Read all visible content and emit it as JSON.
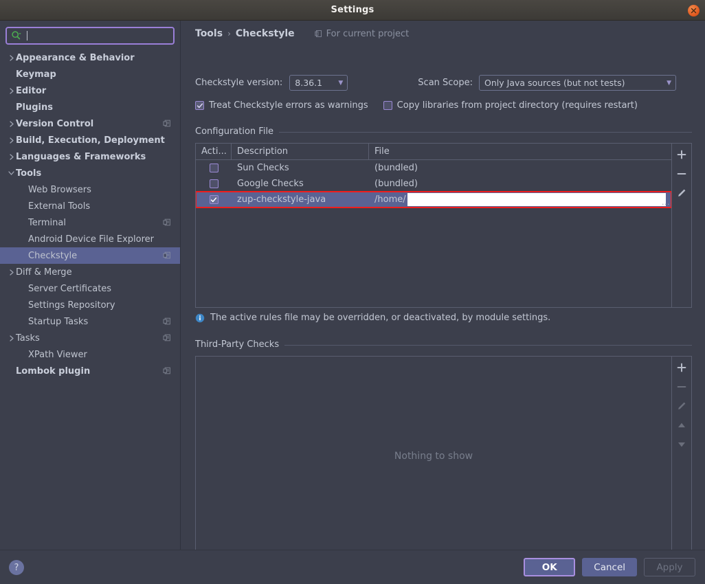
{
  "window": {
    "title": "Settings",
    "close_icon": "close-icon"
  },
  "sidebar": {
    "search": {
      "placeholder": "",
      "value": "",
      "icon": "search-icon"
    },
    "items": [
      {
        "label": "Appearance & Behavior",
        "arrow": "right",
        "bold": true,
        "indent": 0,
        "module_icon": false,
        "selected": false
      },
      {
        "label": "Keymap",
        "arrow": "",
        "bold": true,
        "indent": 0,
        "module_icon": false,
        "selected": false
      },
      {
        "label": "Editor",
        "arrow": "right",
        "bold": true,
        "indent": 0,
        "module_icon": false,
        "selected": false
      },
      {
        "label": "Plugins",
        "arrow": "",
        "bold": true,
        "indent": 0,
        "module_icon": false,
        "selected": false
      },
      {
        "label": "Version Control",
        "arrow": "right",
        "bold": true,
        "indent": 0,
        "module_icon": true,
        "selected": false
      },
      {
        "label": "Build, Execution, Deployment",
        "arrow": "right",
        "bold": true,
        "indent": 0,
        "module_icon": false,
        "selected": false
      },
      {
        "label": "Languages & Frameworks",
        "arrow": "right",
        "bold": true,
        "indent": 0,
        "module_icon": false,
        "selected": false
      },
      {
        "label": "Tools",
        "arrow": "down",
        "bold": true,
        "indent": 0,
        "module_icon": false,
        "selected": false
      },
      {
        "label": "Web Browsers",
        "arrow": "",
        "bold": false,
        "indent": 1,
        "module_icon": false,
        "selected": false
      },
      {
        "label": "External Tools",
        "arrow": "",
        "bold": false,
        "indent": 1,
        "module_icon": false,
        "selected": false
      },
      {
        "label": "Terminal",
        "arrow": "",
        "bold": false,
        "indent": 1,
        "module_icon": true,
        "selected": false
      },
      {
        "label": "Android Device File Explorer",
        "arrow": "",
        "bold": false,
        "indent": 1,
        "module_icon": false,
        "selected": false
      },
      {
        "label": "Checkstyle",
        "arrow": "",
        "bold": false,
        "indent": 1,
        "module_icon": true,
        "selected": true
      },
      {
        "label": "Diff & Merge",
        "arrow": "right",
        "bold": false,
        "indent": 0,
        "module_icon": false,
        "selected": false
      },
      {
        "label": "Server Certificates",
        "arrow": "",
        "bold": false,
        "indent": 1,
        "module_icon": false,
        "selected": false
      },
      {
        "label": "Settings Repository",
        "arrow": "",
        "bold": false,
        "indent": 1,
        "module_icon": false,
        "selected": false
      },
      {
        "label": "Startup Tasks",
        "arrow": "",
        "bold": false,
        "indent": 1,
        "module_icon": true,
        "selected": false
      },
      {
        "label": "Tasks",
        "arrow": "right",
        "bold": false,
        "indent": 0,
        "module_icon": true,
        "selected": false
      },
      {
        "label": "XPath Viewer",
        "arrow": "",
        "bold": false,
        "indent": 1,
        "module_icon": false,
        "selected": false
      },
      {
        "label": "Lombok plugin",
        "arrow": "",
        "bold": true,
        "indent": 0,
        "module_icon": true,
        "selected": false
      }
    ]
  },
  "content": {
    "breadcrumb": {
      "parent": "Tools",
      "separator": "›",
      "current": "Checkstyle"
    },
    "for_current_project": "For current project",
    "version": {
      "label": "Checkstyle version:",
      "value": "8.36.1"
    },
    "scan_scope": {
      "label": "Scan Scope:",
      "value": "Only Java sources (but not tests)"
    },
    "treat_errors": {
      "label": "Treat Checkstyle errors as warnings",
      "checked": true
    },
    "copy_libraries": {
      "label": "Copy libraries from project directory (requires restart)",
      "checked": false
    },
    "configuration_file": {
      "title": "Configuration File",
      "columns": [
        "Acti...",
        "Description",
        "File"
      ],
      "rows": [
        {
          "active": false,
          "description": "Sun Checks",
          "file": "(bundled)",
          "selected": false,
          "redacted": false
        },
        {
          "active": false,
          "description": "Google Checks",
          "file": "(bundled)",
          "selected": false,
          "redacted": false
        },
        {
          "active": true,
          "description": "zup-checkstyle-java",
          "file": "/home/",
          "selected": true,
          "redacted": true,
          "redact_dots": "..."
        }
      ],
      "toolbar": [
        {
          "name": "add-icon",
          "label": "+",
          "enabled": true
        },
        {
          "name": "remove-icon",
          "label": "−",
          "enabled": true
        },
        {
          "name": "edit-icon",
          "label": "pencil",
          "enabled": true
        }
      ]
    },
    "info_message": "The active rules file may be overridden, or deactivated, by module settings.",
    "third_party_checks": {
      "title": "Third-Party Checks",
      "empty_text": "Nothing to show",
      "toolbar": [
        {
          "name": "add-icon",
          "label": "+",
          "enabled": true
        },
        {
          "name": "remove-icon",
          "label": "−",
          "enabled": false
        },
        {
          "name": "edit-icon",
          "label": "pencil",
          "enabled": false
        },
        {
          "name": "move-up-icon",
          "label": "▲",
          "enabled": false
        },
        {
          "name": "move-down-icon",
          "label": "▼",
          "enabled": false
        }
      ]
    }
  },
  "footer": {
    "help": "?",
    "ok": "OK",
    "cancel": "Cancel",
    "apply": "Apply"
  },
  "colors": {
    "background": "#3c3f4c",
    "selection": "#5a6293",
    "accent_purple": "#9a7fd8",
    "highlight_red": "#ef1d1d",
    "titlebar": "#3c3a36",
    "close_orange": "#e2591f",
    "info_blue": "#3d86c6"
  }
}
